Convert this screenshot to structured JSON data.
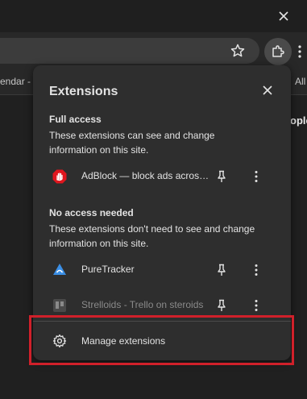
{
  "toolbar": {
    "bookmark_left": "endar -",
    "bookmark_right": "All",
    "page_peek": "ople"
  },
  "popup": {
    "title": "Extensions",
    "full_access": {
      "heading": "Full access",
      "description": "These extensions can see and change information on this site.",
      "items": [
        {
          "name": "AdBlock — block ads across the web",
          "icon": "adblock-icon"
        }
      ]
    },
    "no_access": {
      "heading": "No access needed",
      "description": "These extensions don't need to see and change information on this site.",
      "items": [
        {
          "name": "PureTracker",
          "icon": "puretracker-icon"
        },
        {
          "name": "Strelloids - Trello on steroids",
          "icon": "strelloids-icon"
        }
      ]
    },
    "manage_label": "Manage extensions"
  },
  "colors": {
    "highlight": "#d0202a",
    "adblock_red": "#e0161e",
    "puretracker_blue": "#3b8fe6"
  }
}
